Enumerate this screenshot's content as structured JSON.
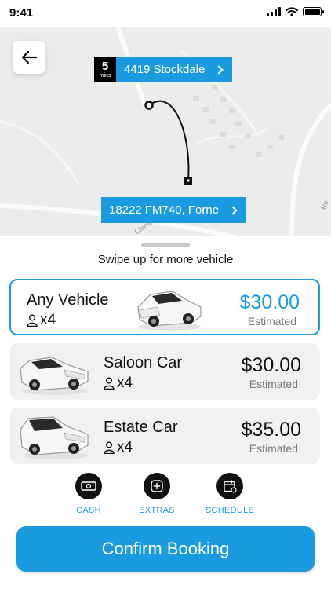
{
  "status_bar": {
    "time": "9:41"
  },
  "map": {
    "pickup": {
      "eta_value": "5",
      "eta_unit": "mins",
      "address": "4419 Stockdale"
    },
    "dropoff": {
      "address": "18222 FM740, Forne"
    },
    "road_labels": [
      "Clemo",
      "Ro"
    ]
  },
  "sheet": {
    "hint": "Swipe up for more vehicle",
    "vehicles": [
      {
        "name": "Any Vehicle",
        "capacity": "x4",
        "price": "$30.00",
        "price_note": "Estimated",
        "selected": true
      },
      {
        "name": "Saloon Car",
        "capacity": "x4",
        "price": "$30.00",
        "price_note": "Estimated",
        "selected": false
      },
      {
        "name": "Estate Car",
        "capacity": "x4",
        "price": "$35.00",
        "price_note": "Estimated",
        "selected": false
      }
    ],
    "options": [
      {
        "label": "CASH",
        "icon": "cash-icon"
      },
      {
        "label": "EXTRAS",
        "icon": "plus-icon"
      },
      {
        "label": "SCHEDULE",
        "icon": "calendar-icon"
      }
    ],
    "confirm_label": "Confirm Booking"
  },
  "colors": {
    "accent": "#1a9be0",
    "dark": "#111111",
    "card": "#f1f1f1",
    "map": "#ececec"
  }
}
